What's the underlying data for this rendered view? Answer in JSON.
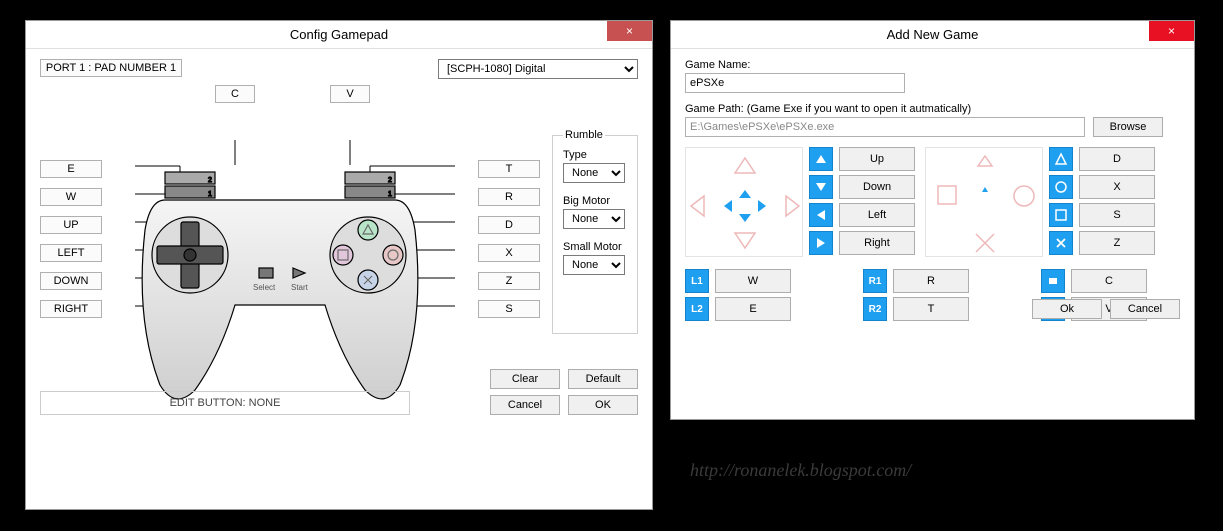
{
  "window1": {
    "title": "Config Gamepad",
    "port": "PORT 1 : PAD NUMBER 1",
    "controller_select": "[SCPH-1080] Digital",
    "buttons_c": "C",
    "buttons_v": "V",
    "left": {
      "e": "E",
      "w": "W",
      "up": "UP",
      "left": "LEFT",
      "down": "DOWN",
      "right": "RIGHT"
    },
    "right": {
      "t": "T",
      "r": "R",
      "d": "D",
      "x": "X",
      "z": "Z",
      "s": "S"
    },
    "pad_labels": {
      "select": "Select",
      "start": "Start"
    },
    "rumble": {
      "legend": "Rumble",
      "type_lbl": "Type",
      "type_val": "None",
      "big_lbl": "Big Motor",
      "big_val": "None",
      "small_lbl": "Small Motor",
      "small_val": "None"
    },
    "edit_status": "EDIT BUTTON: NONE",
    "btn_clear": "Clear",
    "btn_default": "Default",
    "btn_cancel": "Cancel",
    "btn_ok": "OK"
  },
  "window2": {
    "title": "Add New Game",
    "game_name_lbl": "Game Name:",
    "game_name_val": "ePSXe",
    "game_path_lbl": "Game Path: (Game Exe if you want to open it autmatically)",
    "game_path_val": "E:\\Games\\ePSXe\\ePSXe.exe",
    "browse": "Browse",
    "dpad": {
      "up": "Up",
      "down": "Down",
      "left": "Left",
      "right": "Right"
    },
    "face": {
      "d": "D",
      "x": "X",
      "s": "S",
      "z": "Z"
    },
    "shoulders": {
      "l1": "L1",
      "l1_v": "W",
      "l2": "L2",
      "l2_v": "E",
      "r1": "R1",
      "r1_v": "R",
      "r2": "R2",
      "r2_v": "T",
      "sel_v": "C",
      "start_v": "V"
    },
    "ok": "Ok",
    "cancel": "Cancel"
  },
  "watermark": "http://ronanelek.blogspot.com/"
}
